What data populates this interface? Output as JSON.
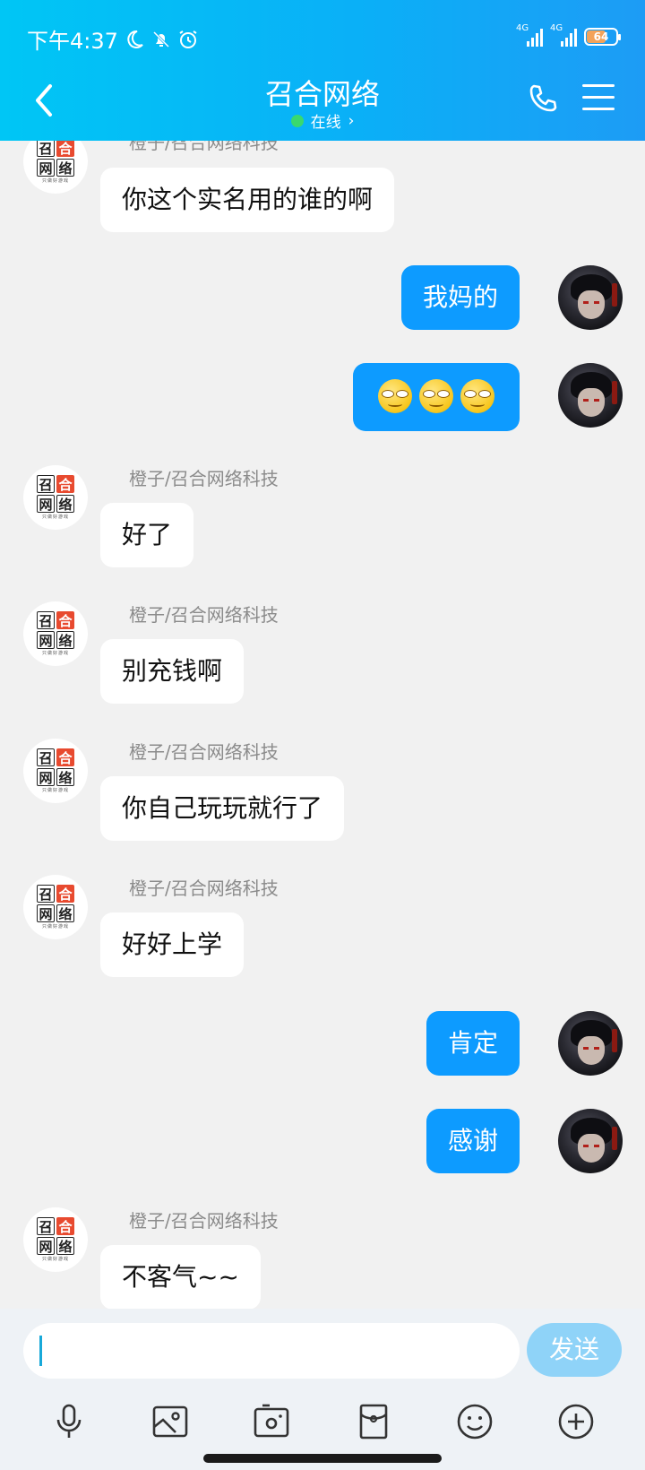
{
  "status_bar": {
    "time": "下午4:37",
    "network_1": "4G",
    "network_2": "4G",
    "battery": "64"
  },
  "header": {
    "title": "召合网络",
    "online_status": "在线",
    "chevron": "›"
  },
  "logo": {
    "tiles": [
      "召",
      "合",
      "网",
      "络"
    ],
    "slogan": "只做好游戏"
  },
  "messages": [
    {
      "side": "in",
      "sender": "橙子/召合网络科技",
      "text": "你这个实名用的谁的啊"
    },
    {
      "side": "out",
      "text": "我妈的"
    },
    {
      "side": "out",
      "text": "",
      "emoji": [
        "grin-emoji",
        "grin-emoji",
        "grin-emoji"
      ]
    },
    {
      "side": "in",
      "sender": "橙子/召合网络科技",
      "text": "好了"
    },
    {
      "side": "in",
      "sender": "橙子/召合网络科技",
      "text": "别充钱啊"
    },
    {
      "side": "in",
      "sender": "橙子/召合网络科技",
      "text": "你自己玩玩就行了"
    },
    {
      "side": "in",
      "sender": "橙子/召合网络科技",
      "text": "好好上学"
    },
    {
      "side": "out",
      "text": "肯定"
    },
    {
      "side": "out",
      "text": "感谢"
    },
    {
      "side": "in",
      "sender": "橙子/召合网络科技",
      "text": "不客气~~"
    }
  ],
  "composer": {
    "input_value": "",
    "send_label": "发送"
  },
  "toolbar": {
    "icons": [
      "microphone-icon",
      "image-icon",
      "camera-icon",
      "red-packet-icon",
      "emoji-icon",
      "plus-icon"
    ]
  },
  "colors": {
    "header_start": "#00c6f5",
    "header_end": "#1d9cf5",
    "outgoing_bubble": "#0d9bff",
    "send_button": "#8fd3f8",
    "online_dot": "#39d96f"
  }
}
